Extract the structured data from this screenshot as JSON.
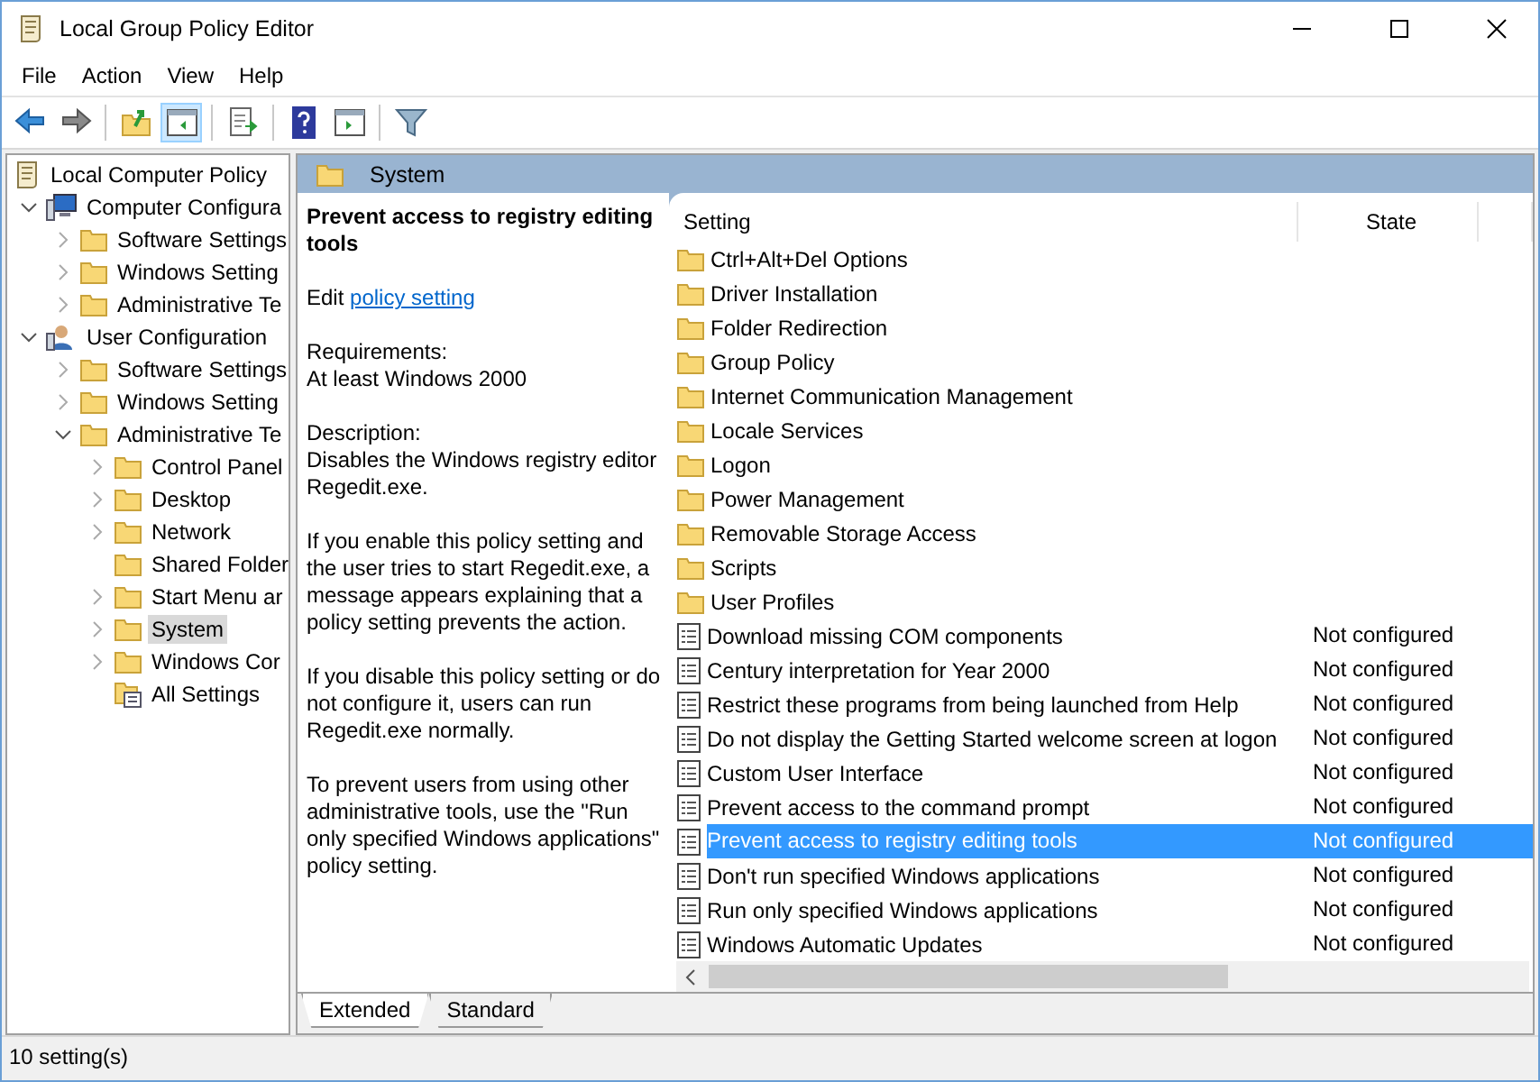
{
  "window": {
    "title": "Local Group Policy Editor"
  },
  "menu": [
    "File",
    "Action",
    "View",
    "Help"
  ],
  "toolbar": [
    {
      "kind": "back",
      "pressed": false
    },
    {
      "kind": "forward",
      "pressed": false
    },
    {
      "kind": "sep"
    },
    {
      "kind": "up",
      "pressed": false
    },
    {
      "kind": "tree",
      "pressed": true
    },
    {
      "kind": "sep"
    },
    {
      "kind": "export",
      "pressed": false
    },
    {
      "kind": "sep"
    },
    {
      "kind": "help",
      "pressed": false
    },
    {
      "kind": "pane",
      "pressed": false
    },
    {
      "kind": "sep"
    },
    {
      "kind": "filter",
      "pressed": false
    }
  ],
  "tree": [
    {
      "label": "Local Computer Policy",
      "kind": "scroll",
      "selected": false,
      "children": [
        {
          "label": "Computer Configura",
          "kind": "computer",
          "expanded": true,
          "selected": false,
          "children": [
            {
              "label": "Software Settings",
              "kind": "folder",
              "expanded": false,
              "selected": false
            },
            {
              "label": "Windows Setting",
              "kind": "folder",
              "expanded": false,
              "selected": false
            },
            {
              "label": "Administrative Te",
              "kind": "folder",
              "expanded": false,
              "selected": false
            }
          ]
        },
        {
          "label": "User Configuration",
          "kind": "user",
          "expanded": true,
          "selected": false,
          "children": [
            {
              "label": "Software Settings",
              "kind": "folder",
              "expanded": false,
              "selected": false
            },
            {
              "label": "Windows Setting",
              "kind": "folder",
              "expanded": false,
              "selected": false
            },
            {
              "label": "Administrative Te",
              "kind": "folder",
              "expanded": true,
              "selected": false,
              "children": [
                {
                  "label": "Control Panel",
                  "kind": "folder",
                  "expanded": false,
                  "selected": false
                },
                {
                  "label": "Desktop",
                  "kind": "folder",
                  "expanded": false,
                  "selected": false
                },
                {
                  "label": "Network",
                  "kind": "folder",
                  "expanded": false,
                  "selected": false
                },
                {
                  "label": "Shared Folder",
                  "kind": "folder",
                  "selected": false
                },
                {
                  "label": "Start Menu ar",
                  "kind": "folder",
                  "expanded": false,
                  "selected": false
                },
                {
                  "label": "System",
                  "kind": "folder",
                  "expanded": false,
                  "selected": true
                },
                {
                  "label": "Windows Cor",
                  "kind": "folder",
                  "expanded": false,
                  "selected": false
                },
                {
                  "label": "All Settings",
                  "kind": "allsettings",
                  "selected": false
                }
              ]
            }
          ]
        }
      ]
    }
  ],
  "header": {
    "title": "System"
  },
  "description": {
    "title": "Prevent access to registry editing tools",
    "edit_prefix": "Edit",
    "edit_link": "policy setting",
    "paragraphs": [
      "Requirements:\nAt least Windows 2000",
      "Description:\nDisables the Windows registry editor Regedit.exe.",
      "If you enable this policy setting and the user tries to start Regedit.exe, a message appears explaining that a policy setting prevents the action.",
      "If you disable this policy setting or do not configure it, users can run Regedit.exe normally.",
      "To prevent users from using other administrative tools, use the \"Run only specified Windows applications\" policy setting."
    ]
  },
  "table": {
    "columns": [
      "Setting",
      "State"
    ],
    "rows": [
      {
        "kind": "folder",
        "name": "Ctrl+Alt+Del Options",
        "selected": false
      },
      {
        "kind": "folder",
        "name": "Driver Installation",
        "selected": false
      },
      {
        "kind": "folder",
        "name": "Folder Redirection",
        "selected": false
      },
      {
        "kind": "folder",
        "name": "Group Policy",
        "selected": false
      },
      {
        "kind": "folder",
        "name": "Internet Communication Management",
        "selected": false
      },
      {
        "kind": "folder",
        "name": "Locale Services",
        "selected": false
      },
      {
        "kind": "folder",
        "name": "Logon",
        "selected": false
      },
      {
        "kind": "folder",
        "name": "Power Management",
        "selected": false
      },
      {
        "kind": "folder",
        "name": "Removable Storage Access",
        "selected": false
      },
      {
        "kind": "folder",
        "name": "Scripts",
        "selected": false
      },
      {
        "kind": "folder",
        "name": "User Profiles",
        "selected": false
      },
      {
        "kind": "setting",
        "name": "Download missing COM components",
        "state": "Not configured",
        "selected": false
      },
      {
        "kind": "setting",
        "name": "Century interpretation for Year 2000",
        "state": "Not configured",
        "selected": false
      },
      {
        "kind": "setting",
        "name": "Restrict these programs from being launched from Help",
        "state": "Not configured",
        "selected": false
      },
      {
        "kind": "setting",
        "name": "Do not display the Getting Started welcome screen at logon",
        "state": "Not configured",
        "selected": false
      },
      {
        "kind": "setting",
        "name": "Custom User Interface",
        "state": "Not configured",
        "selected": false
      },
      {
        "kind": "setting",
        "name": "Prevent access to the command prompt",
        "state": "Not configured",
        "selected": false
      },
      {
        "kind": "setting",
        "name": "Prevent access to registry editing tools",
        "state": "Not configured",
        "selected": true
      },
      {
        "kind": "setting",
        "name": "Don't run specified Windows applications",
        "state": "Not configured",
        "selected": false
      },
      {
        "kind": "setting",
        "name": "Run only specified Windows applications",
        "state": "Not configured",
        "selected": false
      },
      {
        "kind": "setting",
        "name": "Windows Automatic Updates",
        "state": "Not configured",
        "selected": false
      }
    ]
  },
  "view_tabs": [
    {
      "label": "Extended",
      "selected": true
    },
    {
      "label": "Standard",
      "selected": false
    }
  ],
  "status_bar": "10 setting(s)"
}
